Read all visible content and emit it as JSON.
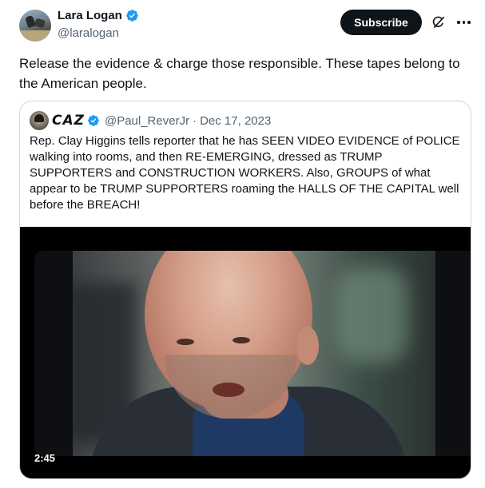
{
  "author": {
    "display_name": "Lara Logan",
    "handle": "@laralogan"
  },
  "actions": {
    "subscribe_label": "Subscribe",
    "grok_icon": "grok-icon",
    "more_icon": "more-icon"
  },
  "tweet": {
    "text": "Release the evidence & charge those responsible. These tapes belong to the American people."
  },
  "quote": {
    "display_name": "CAZ",
    "handle": "@Paul_ReverJr",
    "separator": "·",
    "date": "Dec 17, 2023",
    "text": "Rep. Clay Higgins tells reporter that he has SEEN VIDEO EVIDENCE of POLICE walking into rooms, and then RE-EMERGING, dressed as TRUMP SUPPORTERS and CONSTRUCTION WORKERS. Also, GROUPS of what appear to be TRUMP SUPPORTERS roaming the HALLS OF THE CAPITAL well before the BREACH!",
    "video": {
      "duration": "2:45"
    }
  },
  "colors": {
    "verified_blue": "#1d9bf0",
    "text_primary": "#0f1419",
    "text_secondary": "#536471",
    "border": "#cfd9de"
  }
}
